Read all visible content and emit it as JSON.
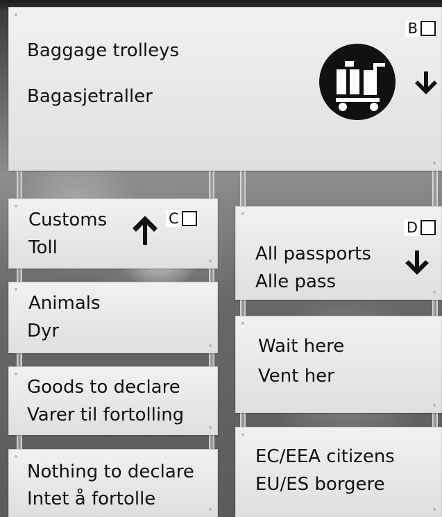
{
  "signs": {
    "baggage": {
      "label_en": "Baggage trolleys",
      "label_no": "Bagasjetraller",
      "option_letter": "B"
    },
    "customs": {
      "label_en": "Customs",
      "label_no": "Toll",
      "option_letter": "C"
    },
    "animals": {
      "label_en": "Animals",
      "label_no": "Dyr"
    },
    "goods": {
      "label_en": "Goods to declare",
      "label_no": "Varer til fortolling"
    },
    "nothing": {
      "label_en": "Nothing to declare",
      "label_no": "Intet å fortolle"
    },
    "passports": {
      "label_en": "All passports",
      "label_no": "Alle pass",
      "option_letter": "D"
    },
    "wait": {
      "label_en": "Wait here",
      "label_no": "Vent her"
    },
    "citizens": {
      "label_en": "EC/EEA citizens",
      "label_no": "EU/ES borgere"
    }
  },
  "icons": {
    "trolley": "baggage-trolley-icon",
    "down_arrow": "arrow-down-icon",
    "up_arrow": "arrow-up-icon"
  }
}
